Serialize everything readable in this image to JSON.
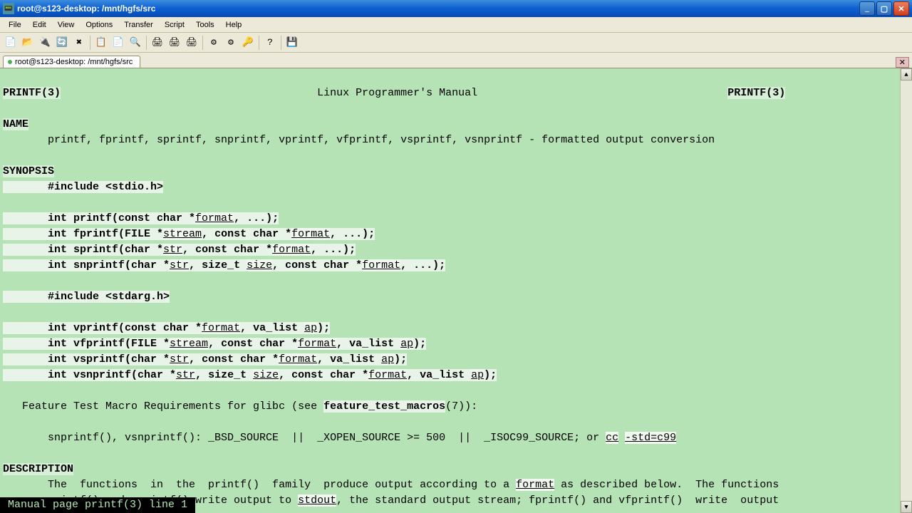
{
  "window": {
    "title": "root@s123-desktop: /mnt/hgfs/src"
  },
  "menu": {
    "file": "File",
    "edit": "Edit",
    "view": "View",
    "options": "Options",
    "transfer": "Transfer",
    "script": "Script",
    "tools": "Tools",
    "help": "Help"
  },
  "tab": {
    "label": "root@s123-desktop: /mnt/hgfs/src"
  },
  "man": {
    "header_left": "PRINTF(3)",
    "header_center": "Linux Programmer's Manual",
    "header_right": "PRINTF(3)",
    "name_hdr": "NAME",
    "name_line": "       printf, fprintf, sprintf, snprintf, vprintf, vfprintf, vsprintf, vsnprintf - formatted output conversion",
    "synopsis_hdr": "SYNOPSIS",
    "inc1": "       #include <stdio.h>",
    "l1a": "       int printf(const char *",
    "l1b": ", ...);",
    "l2a": "       int fprintf(FILE *",
    "l2b": ", const char *",
    "l2c": ", ...);",
    "l3a": "       int sprintf(char *",
    "l3b": ", const char *",
    "l3c": ", ...);",
    "l4a": "       int snprintf(char *",
    "l4b": ", size_t ",
    "l4c": ", const char *",
    "l4d": ", ...);",
    "inc2": "       #include <stdarg.h>",
    "l5a": "       int vprintf(const char *",
    "l5b": ", va_list ",
    "l5c": ");",
    "l6a": "       int vfprintf(FILE *",
    "l6b": ", const char *",
    "l6c": ", va_list ",
    "l6d": ");",
    "l7a": "       int vsprintf(char *",
    "l7b": ", const char *",
    "l7c": ", va_list ",
    "l7d": ");",
    "l8a": "       int vsnprintf(char *",
    "l8b": ", size_t ",
    "l8c": ", const char *",
    "l8d": ", va_list ",
    "l8e": ");",
    "ftm1": "   Feature Test Macro Requirements for glibc (see ",
    "ftm_macro": "feature_test_macros",
    "ftm2": "(7)):",
    "ftb1": "       snprintf(), vsnprintf(): _BSD_SOURCE  ||  _XOPEN_SOURCE >= 500  ||  _ISOC99_SOURCE; or ",
    "ftb_cc": "cc",
    "ftb_sp": " ",
    "ftb_std": "-std=c99",
    "desc_hdr": "DESCRIPTION",
    "desc1a": "       The  functions  in  the  printf()  family  produce output according to a ",
    "desc1b": " as described below.  The functions",
    "desc2a": "       printf() and vprintf() write output to ",
    "desc2b": ", the standard output stream; fprintf() and vfprintf()  write  output",
    "u_format": "format",
    "u_stream": "stream",
    "u_str": "str",
    "u_size": "size",
    "u_ap": "ap",
    "u_stdout": "stdout",
    "status": " Manual page printf(3) line 1"
  },
  "icons": {
    "new": "📄",
    "open": "📂",
    "disconnect": "🔌",
    "reconnect": "🔄",
    "cancel": "✖",
    "copy": "📋",
    "paste": "📄",
    "find": "🔍",
    "print": "🖨",
    "props": "⚙",
    "key": "🔑",
    "help": "?",
    "save": "💾"
  }
}
